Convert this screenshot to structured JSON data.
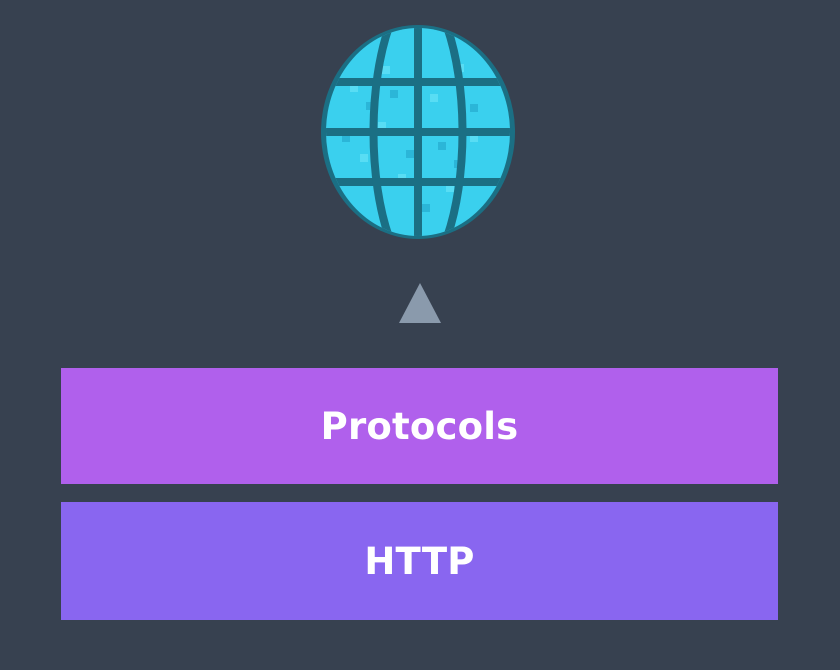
{
  "diagram": {
    "icon": "globe-icon",
    "connector": "arrow-up-icon",
    "layers": [
      {
        "label": "Protocols",
        "color": "#b060ec"
      },
      {
        "label": "HTTP",
        "color": "#8966f0"
      }
    ],
    "colors": {
      "background": "#374150",
      "globe_fill": "#3ad0ee",
      "globe_dark": "#1b6f84",
      "arrow": "#8a9aac"
    }
  }
}
